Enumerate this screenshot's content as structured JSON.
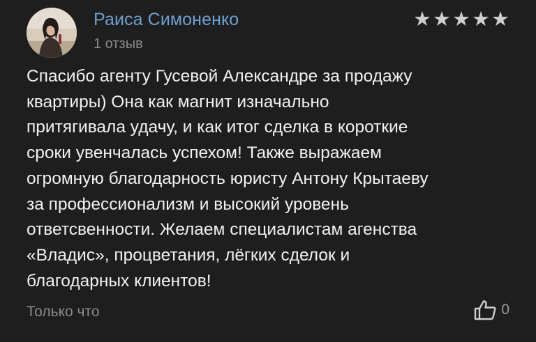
{
  "author": {
    "name": "Раиса Симоненко",
    "meta": "1 отзыв"
  },
  "rating": {
    "value": 5,
    "max": 5,
    "filled_color": "#cfcfcf"
  },
  "review": {
    "lines": [
      "Спасибо агенту Гусевой Александре за продажу",
      "квартиры) Она как магнит изначально",
      "притягивала удачу, и как итог сделка в короткие",
      "сроки увенчалась успехом! Также выражаем",
      "огромную благодарность юристу Антону Крытаеву",
      "за профессионализм и высокий уровень",
      "ответсвенности. Желаем специалистам агенства",
      "«Владис», процветания, лёгких сделок и",
      "благодарных клиентов!"
    ]
  },
  "footer": {
    "timestamp": "Только что",
    "like_icon": "thumbs-up-icon",
    "likes": "0"
  },
  "colors": {
    "background": "#1e1e1e",
    "author_name": "#6f9fd0",
    "text": "#f2f2f2",
    "muted": "#8a8a8a"
  }
}
